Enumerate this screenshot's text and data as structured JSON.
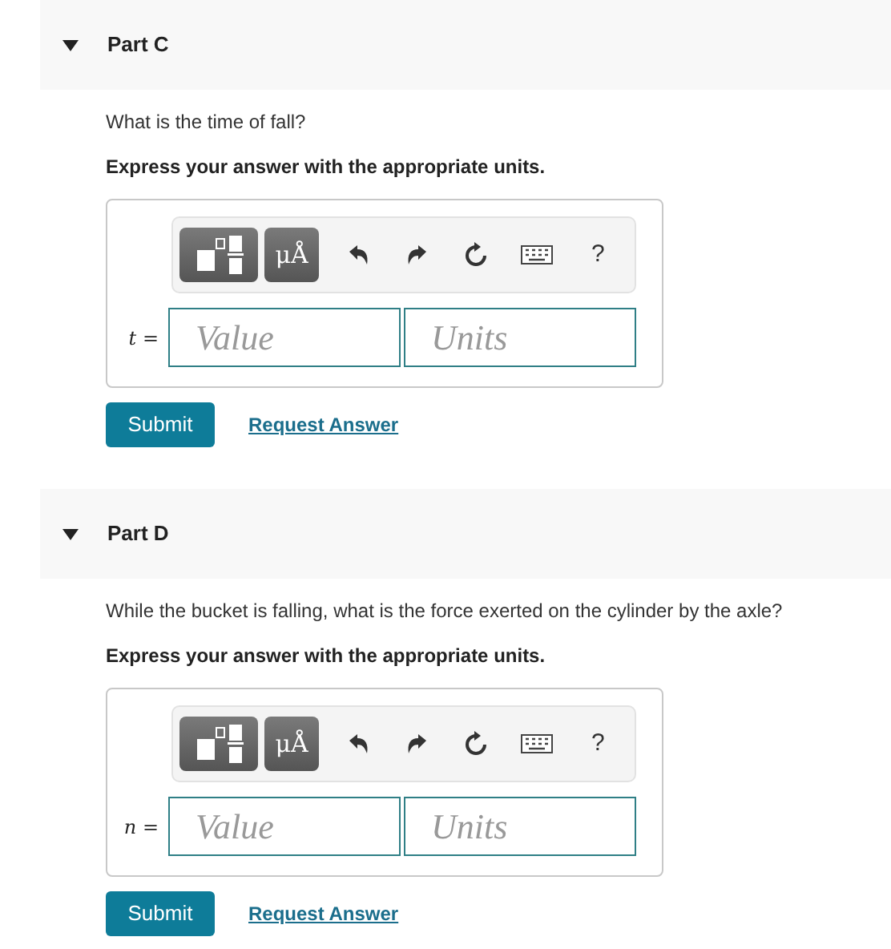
{
  "parts": [
    {
      "title": "Part C",
      "expanded": true,
      "question": "What is the time of fall?",
      "instruction": "Express your answer with the appropriate units.",
      "toolbar": {
        "units_button": "μÅ",
        "help": "?"
      },
      "variable": "*t* =",
      "value_placeholder": "Value",
      "units_placeholder": "Units",
      "submit": "Submit",
      "request": "Request Answer"
    },
    {
      "title": "Part D",
      "expanded": true,
      "question": "While the bucket is falling, what is the force exerted on the cylinder by the axle?",
      "instruction": "Express your answer with the appropriate units.",
      "toolbar": {
        "units_button": "μÅ",
        "help": "?"
      },
      "variable": "*n* =",
      "value_placeholder": "Value",
      "units_placeholder": "Units",
      "submit": "Submit",
      "request": "Request Answer"
    }
  ]
}
